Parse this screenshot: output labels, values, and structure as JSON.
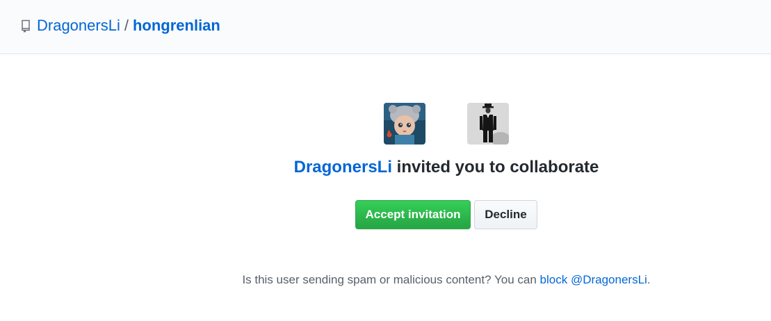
{
  "header": {
    "owner": "DragonersLi",
    "separator": "/",
    "repo": "hongrenlian",
    "repo_icon": "repo-book-icon"
  },
  "invitation": {
    "inviter": "DragonersLi",
    "message": " invited you to collaborate",
    "inviter_avatar": "doll-avatar",
    "invitee_avatar": "person-in-hat-avatar"
  },
  "actions": {
    "accept_label": "Accept invitation",
    "decline_label": "Decline"
  },
  "spam": {
    "prefix": "Is this user sending spam or malicious content? You can ",
    "link": "block @DragonersLi",
    "suffix": "."
  },
  "colors": {
    "link": "#0366d6",
    "accept": "#28a745",
    "header_bg": "#fafbfc"
  }
}
